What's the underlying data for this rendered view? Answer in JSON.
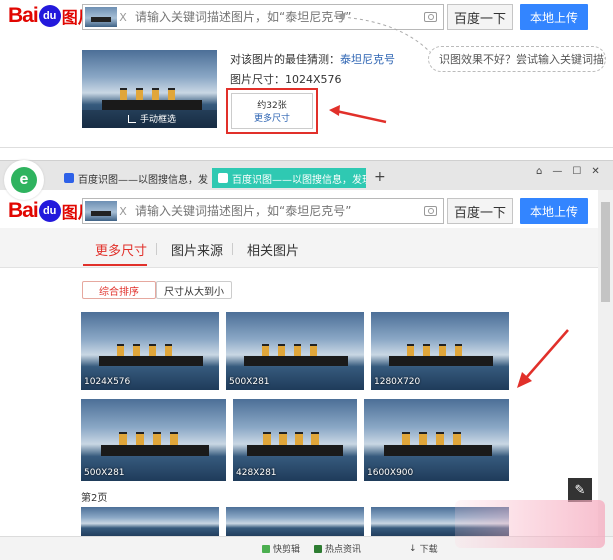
{
  "logo": {
    "part1": "Bai",
    "part2": "du",
    "part3": "图片"
  },
  "search": {
    "placeholder": "请输入关键词描述图片，如“泰坦尼克号”",
    "thumb_close": "X",
    "search_button": "百度一下",
    "upload_button": "本地上传"
  },
  "result": {
    "guess_prefix": "对该图片的最佳猜测：",
    "guess_link": "泰坦尼克号",
    "size_label": "图片尺寸：1024X576",
    "crop_label": "手动框选",
    "more_count": "约32张",
    "more_label": "更多尺寸",
    "hint": "识图效果不好？尝试输入关键词描述图"
  },
  "browser": {
    "tabs": [
      {
        "label": "百度识图——以图搜信息，发现",
        "close": "X",
        "active": false
      },
      {
        "label": "百度识图——以图搜信息，发现",
        "close": "X",
        "active": true
      }
    ],
    "new_tab": "+",
    "window_controls": [
      "⌂",
      "—",
      "☐",
      "✕"
    ]
  },
  "sections": {
    "tabs": [
      "更多尺寸",
      "图片来源",
      "相关图片"
    ],
    "active_index": 0
  },
  "filters": [
    "综合排序",
    "尺寸从大到小"
  ],
  "images": [
    {
      "label": "1024X576"
    },
    {
      "label": "500X281"
    },
    {
      "label": "1280X720"
    },
    {
      "label": "500X281"
    },
    {
      "label": "428X281"
    },
    {
      "label": "1600X900"
    }
  ],
  "page2_label": "第2页",
  "status_bar": [
    "快剪辑",
    "热点资讯",
    "下载"
  ],
  "colors": {
    "accent_red": "#e1302a",
    "baidu_blue": "#3385ff",
    "active_tab": "#2fc9b2"
  }
}
